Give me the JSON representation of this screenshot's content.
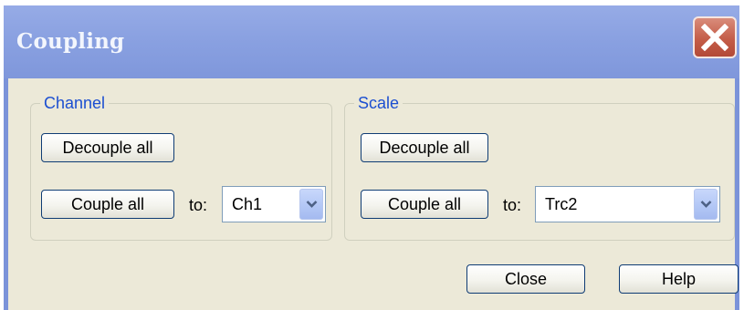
{
  "window": {
    "title": "Coupling",
    "close_icon": "close-x-icon"
  },
  "channel": {
    "group_title": "Channel",
    "decouple_label": "Decouple all",
    "couple_label": "Couple all",
    "to_label": "to:",
    "selected": "Ch1"
  },
  "scale": {
    "group_title": "Scale",
    "decouple_label": "Decouple all",
    "couple_label": "Couple all",
    "to_label": "to:",
    "selected": "Trc2"
  },
  "footer": {
    "close_label": "Close",
    "help_label": "Help"
  },
  "colors": {
    "title_bar": "#8aa1e1",
    "client_bg": "#ece9d8",
    "group_title": "#1c4fd1",
    "close_button": "#c45d48"
  }
}
